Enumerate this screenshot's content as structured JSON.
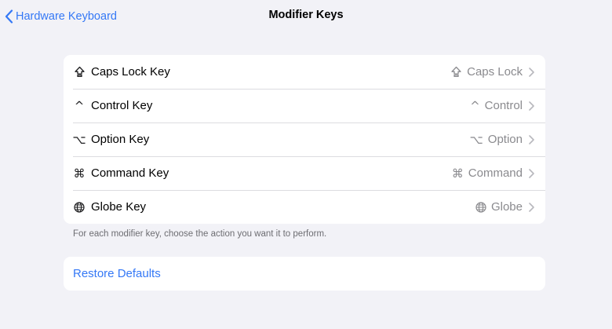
{
  "navbar": {
    "back_label": "Hardware Keyboard",
    "title": "Modifier Keys"
  },
  "keys": [
    {
      "label": "Caps Lock Key",
      "value": "Caps Lock",
      "icon": "caps-lock-icon"
    },
    {
      "label": "Control Key",
      "value": "Control",
      "icon": "control-icon",
      "glyph": "^"
    },
    {
      "label": "Option Key",
      "value": "Option",
      "icon": "option-icon",
      "glyph": "⌥"
    },
    {
      "label": "Command Key",
      "value": "Command",
      "icon": "command-icon",
      "glyph": "⌘"
    },
    {
      "label": "Globe Key",
      "value": "Globe",
      "icon": "globe-icon"
    }
  ],
  "footnote": "For each modifier key, choose the action you want it to perform.",
  "restore_label": "Restore Defaults",
  "colors": {
    "background": "#f2f2f7",
    "accent": "#3478f6",
    "secondary_text": "#8a8a8e"
  }
}
